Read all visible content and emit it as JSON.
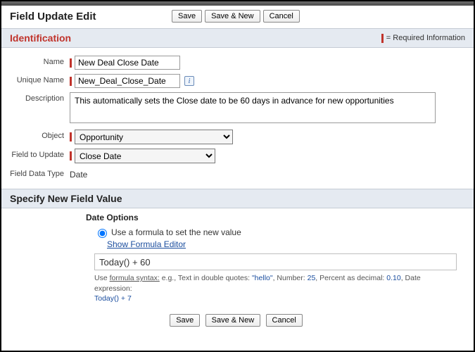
{
  "page_title": "Field Update Edit",
  "buttons": {
    "save": "Save",
    "save_new": "Save & New",
    "cancel": "Cancel"
  },
  "sections": {
    "identification": "Identification",
    "specify": "Specify New Field Value"
  },
  "required_label": "= Required Information",
  "labels": {
    "name": "Name",
    "unique_name": "Unique Name",
    "description": "Description",
    "object": "Object",
    "field_to_update": "Field to Update",
    "field_data_type": "Field Data Type",
    "date_options": "Date Options",
    "use_formula": "Use a formula to set the new value",
    "show_editor": "Show Formula Editor"
  },
  "values": {
    "name": "New Deal Close Date",
    "unique_name": "New_Deal_Close_Date",
    "description": "This automatically sets the Close date to be 60 days in advance for new opportunities",
    "object": "Opportunity",
    "field_to_update": "Close Date",
    "field_data_type": "Date",
    "formula": "Today() + 60"
  },
  "hint": {
    "pre": "Use ",
    "syntax": "formula syntax:",
    "body": " e.g., Text in double quotes: ",
    "v1": "\"hello\"",
    "mid1": ", Number: ",
    "v2": "25",
    "mid2": ", Percent as decimal: ",
    "v3": "0.10",
    "mid3": ", Date expression:",
    "v4": "Today() + 7"
  }
}
